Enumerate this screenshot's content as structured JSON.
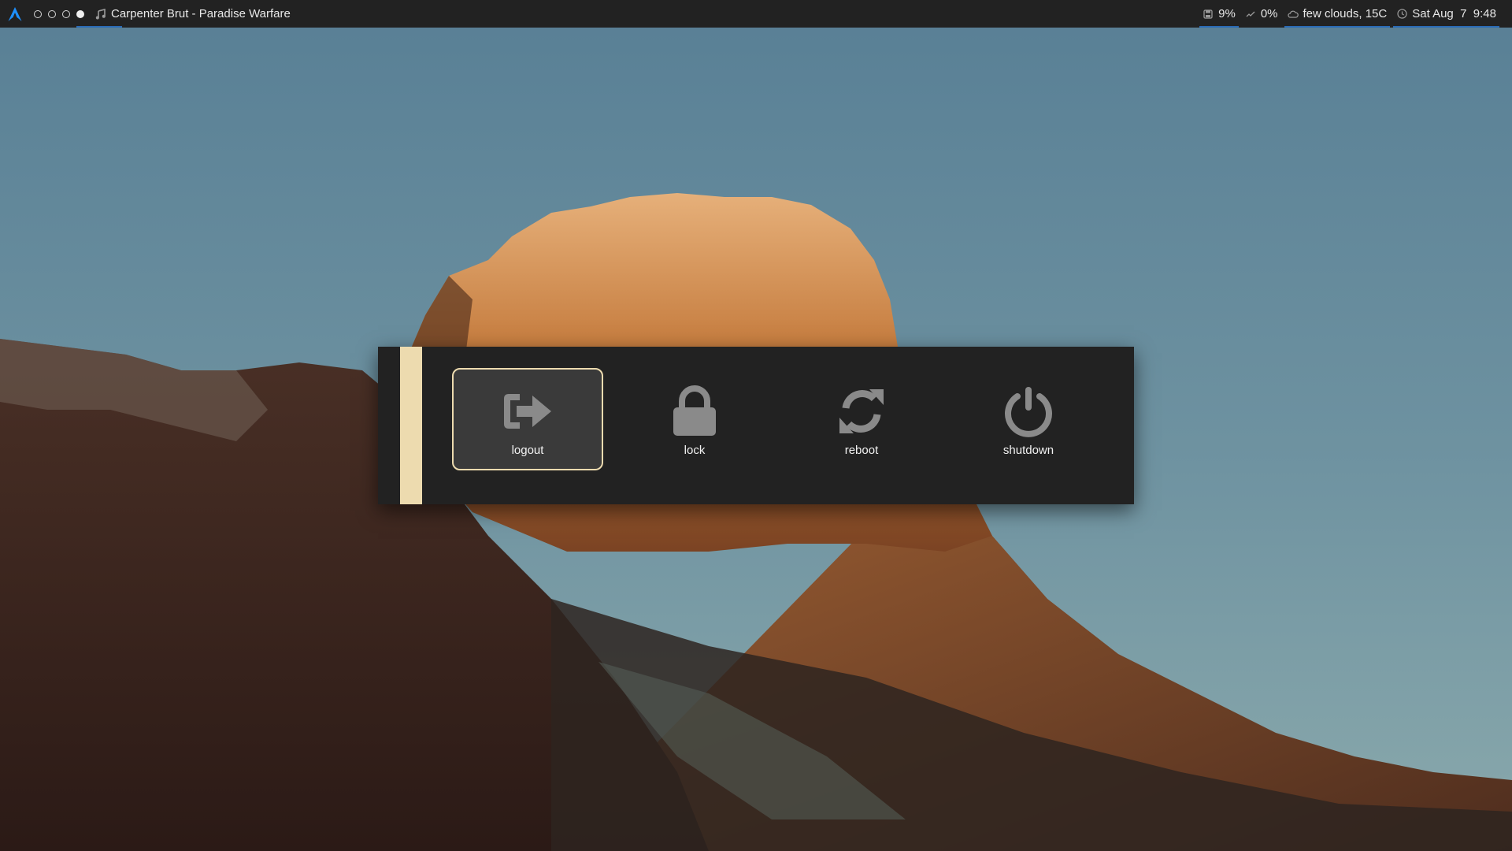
{
  "colors": {
    "bar_bg": "#222222",
    "menu_bg": "#222222",
    "accent": "#eddbaf",
    "underline": "#2a6bb5",
    "icon_gray": "#8a8a8a"
  },
  "topbar": {
    "logo_icon": "arch-logo-icon",
    "workspaces": [
      {
        "active": false
      },
      {
        "active": false
      },
      {
        "active": false
      },
      {
        "active": true
      }
    ],
    "media": {
      "icon": "music-note-icon",
      "now_playing": "Carpenter Brut - Paradise Warfare"
    },
    "modules": {
      "disk": {
        "icon": "disk-icon",
        "value": "9%"
      },
      "cpu": {
        "icon": "cpu-graph-icon",
        "value": "0%"
      },
      "weather": {
        "icon": "cloud-icon",
        "value": "few clouds, 15C"
      },
      "clock": {
        "icon": "clock-icon",
        "value": "Sat Aug  7  9:48"
      }
    }
  },
  "power_menu": {
    "items": [
      {
        "id": "logout",
        "label": "logout",
        "icon": "logout-icon",
        "selected": true
      },
      {
        "id": "lock",
        "label": "lock",
        "icon": "lock-icon",
        "selected": false
      },
      {
        "id": "reboot",
        "label": "reboot",
        "icon": "reboot-icon",
        "selected": false
      },
      {
        "id": "shutdown",
        "label": "shutdown",
        "icon": "power-icon",
        "selected": false
      }
    ]
  }
}
